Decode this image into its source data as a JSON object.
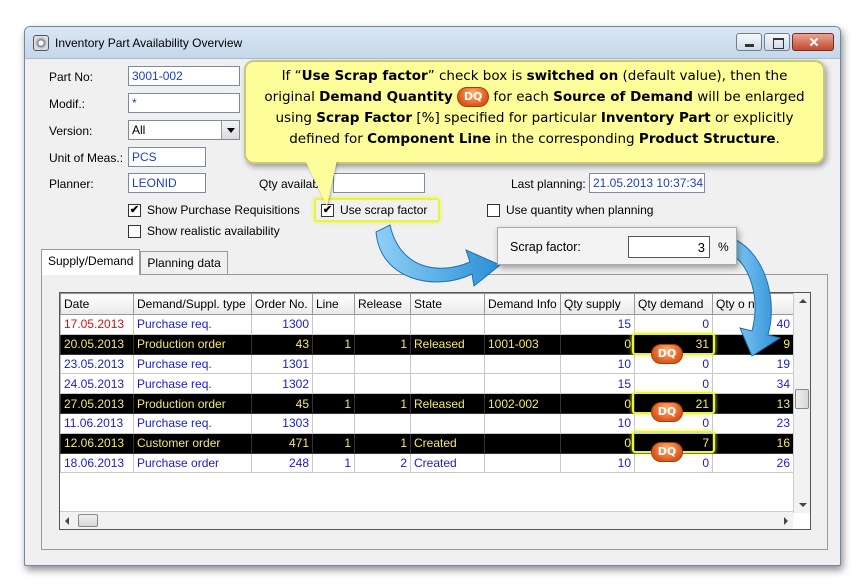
{
  "window": {
    "title": "Inventory Part Availability Overview"
  },
  "form": {
    "part_no_label": "Part No:",
    "part_no": "3001-002",
    "modif_label": "Modif.:",
    "modif": "*",
    "version_label": "Version:",
    "version": "All",
    "unit_label": "Unit of Meas.:",
    "unit": "PCS",
    "planner_label": "Planner:",
    "planner": "LEONID",
    "qty_available_label": "Qty available:",
    "last_planning_label": "Last planning:",
    "last_planning": "21.05.2013 10:37:34",
    "show_purchase_req": "Show Purchase Requisitions",
    "use_scrap_factor": "Use scrap factor",
    "use_quantity_planning": "Use quantity when planning",
    "show_realistic": "Show realistic availability"
  },
  "tabs": [
    "Supply/Demand",
    "Planning data"
  ],
  "table": {
    "headers": [
      "Date",
      "Demand/Suppl. type",
      "Order No.",
      "Line",
      "Release",
      "State",
      "Demand Info",
      "Qty supply",
      "Qty demand",
      "Qty o nd"
    ],
    "rows": [
      {
        "date": "17.05.2013",
        "type": "Purchase req.",
        "order": "1300",
        "line": "",
        "release": "",
        "state": "",
        "info": "",
        "supply": "15",
        "demand": "0",
        "onhand": "40"
      },
      {
        "date": "20.05.2013",
        "type": "Production order",
        "order": "43",
        "line": "1",
        "release": "1",
        "state": "Released",
        "info": "1001-003",
        "supply": "0",
        "demand": "31",
        "onhand": "9"
      },
      {
        "date": "23.05.2013",
        "type": "Purchase req.",
        "order": "1301",
        "line": "",
        "release": "",
        "state": "",
        "info": "",
        "supply": "10",
        "demand": "0",
        "onhand": "19"
      },
      {
        "date": "24.05.2013",
        "type": "Purchase req.",
        "order": "1302",
        "line": "",
        "release": "",
        "state": "",
        "info": "",
        "supply": "15",
        "demand": "0",
        "onhand": "34"
      },
      {
        "date": "27.05.2013",
        "type": "Production order",
        "order": "45",
        "line": "1",
        "release": "1",
        "state": "Released",
        "info": "1002-002",
        "supply": "0",
        "demand": "21",
        "onhand": "13"
      },
      {
        "date": "11.06.2013",
        "type": "Purchase req.",
        "order": "1303",
        "line": "",
        "release": "",
        "state": "",
        "info": "",
        "supply": "10",
        "demand": "0",
        "onhand": "23"
      },
      {
        "date": "12.06.2013",
        "type": "Customer order",
        "order": "471",
        "line": "1",
        "release": "1",
        "state": "Created",
        "info": "",
        "supply": "0",
        "demand": "7",
        "onhand": "16"
      },
      {
        "date": "18.06.2013",
        "type": "Purchase order",
        "order": "248",
        "line": "1",
        "release": "2",
        "state": "Created",
        "info": "",
        "supply": "10",
        "demand": "0",
        "onhand": "26"
      }
    ]
  },
  "callout": {
    "t1": "If “",
    "b1": "Use Scrap factor",
    "t2": "” check box is ",
    "b2": "switched on",
    "t3": " (default value), then the",
    "t4": "original ",
    "b3": "Demand Quantity",
    "t5": " for each ",
    "b4": "Source of Demand",
    "t6": " will be enlarged",
    "t7": "using ",
    "b5": "Scrap Factor",
    "t8": " [%] specified for particular ",
    "b6": "Inventory Part",
    "t9": " or explicitly",
    "t10": "defined for ",
    "b7": "Component Line",
    "t11": " in the corresponding ",
    "b8": "Product Structure",
    "t12": "."
  },
  "dq_badge": "DQ",
  "scrap": {
    "label": "Scrap factor:",
    "value": "3",
    "unit": "%"
  },
  "colors": {
    "accent_yellow": "#e6f53a",
    "callout_bg": "#fdfd9a",
    "arrow_blue": "#3a9ee0",
    "badge_orange": "#e0561a"
  }
}
